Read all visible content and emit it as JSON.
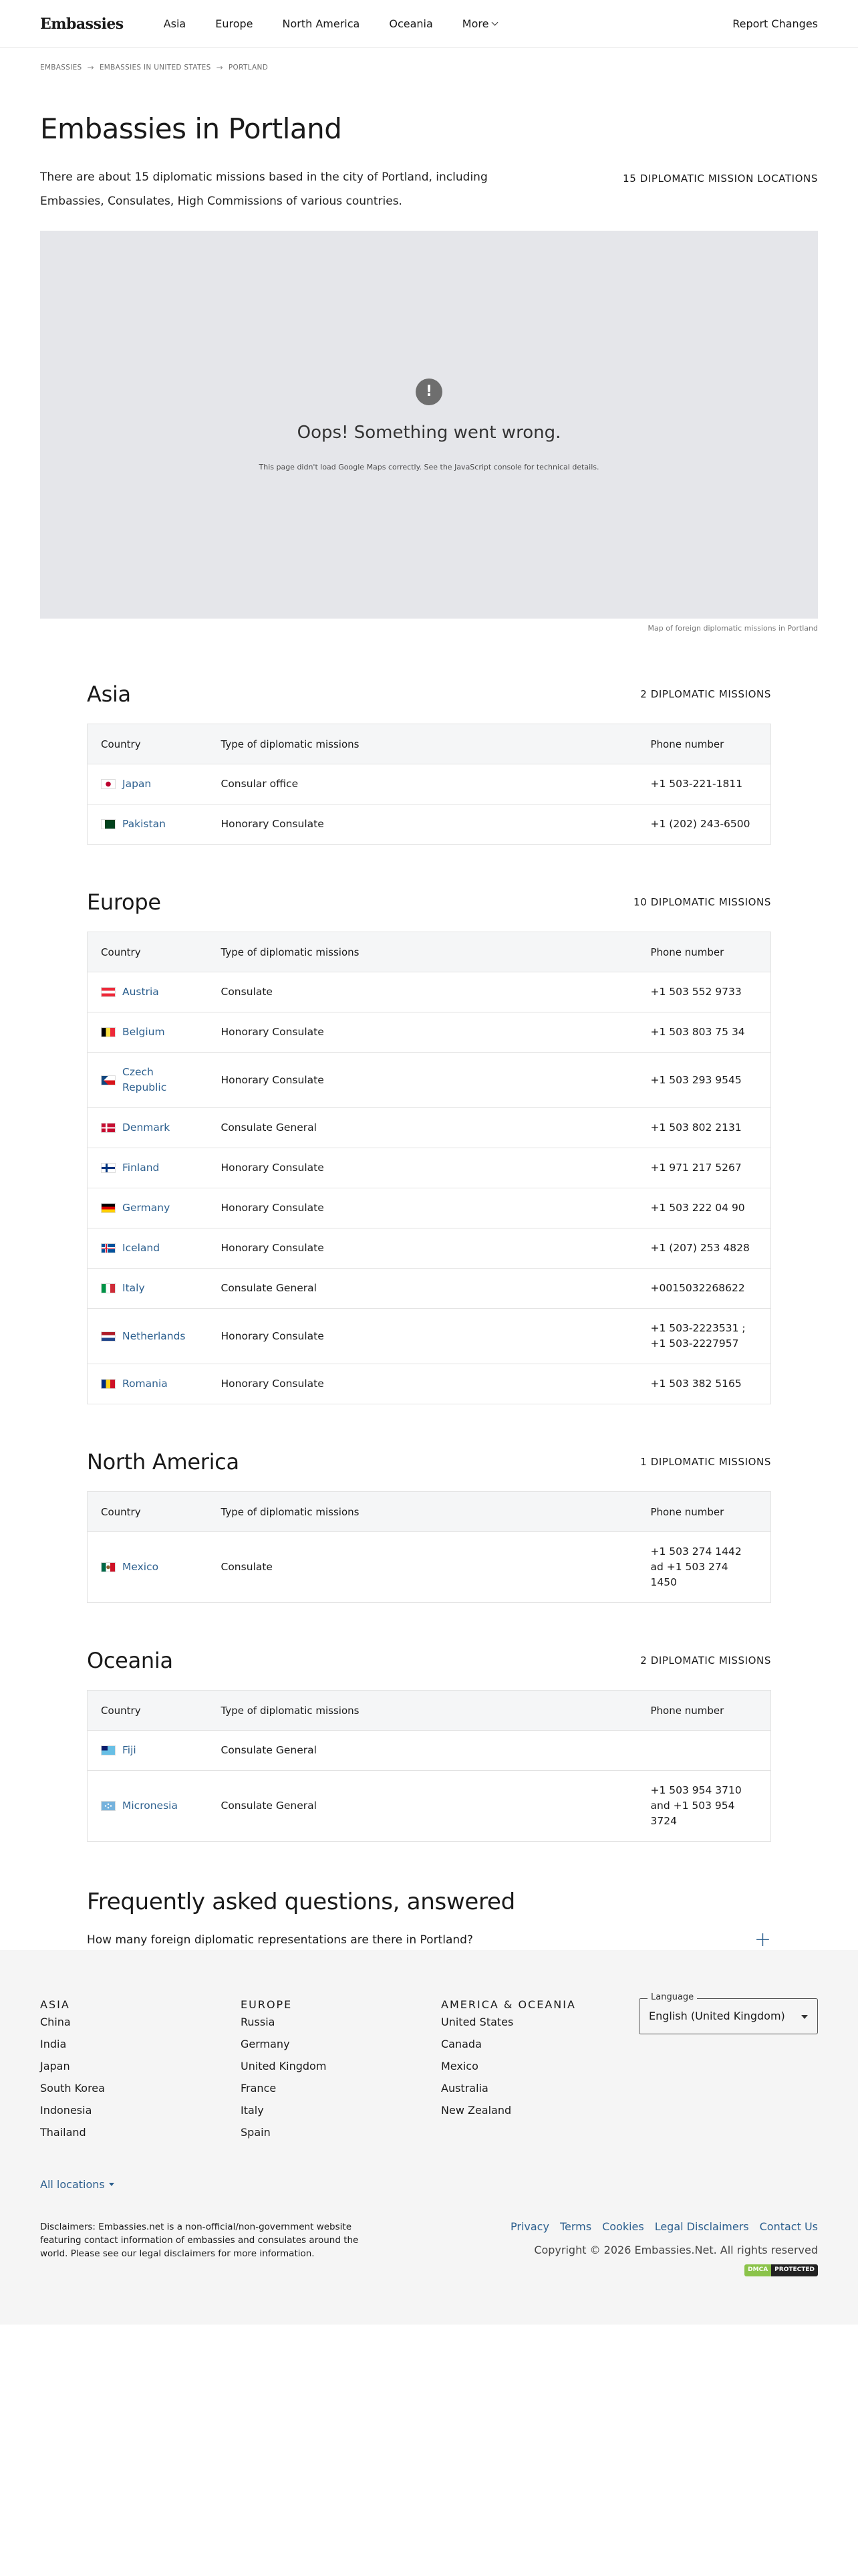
{
  "header": {
    "logo": "Embassies",
    "nav": [
      "Asia",
      "Europe",
      "North America",
      "Oceania",
      "More"
    ],
    "report": "Report Changes"
  },
  "breadcrumb": [
    "EMBASSIES",
    "EMBASSIES IN UNITED STATES",
    "PORTLAND"
  ],
  "hero": {
    "title": "Embassies in Portland",
    "locations": "15 DIPLOMATIC MISSION LOCATIONS",
    "intro": "There are about 15 diplomatic missions based in the city of Portland, including Embassies, Consulates, High Commissions of various countries."
  },
  "map": {
    "error_title": "Oops! Something went wrong.",
    "error_desc": "This page didn't load Google Maps correctly. See the JavaScript console for technical details.",
    "caption": "Map of foreign diplomatic missions in Portland"
  },
  "table_headers": [
    "Country",
    "Type of diplomatic missions",
    "Phone number"
  ],
  "regions": [
    {
      "name": "Asia",
      "count": "2 DIPLOMATIC MISSIONS",
      "rows": [
        {
          "country": "Japan",
          "type": "Consular office",
          "phone": "+1 503-221-1811",
          "flag": "japan"
        },
        {
          "country": "Pakistan",
          "type": "Honorary Consulate",
          "phone": "+1 (202) 243-6500",
          "flag": "pakistan"
        }
      ]
    },
    {
      "name": "Europe",
      "count": "10 DIPLOMATIC MISSIONS",
      "rows": [
        {
          "country": "Austria",
          "type": "Consulate",
          "phone": "+1 503 552 9733",
          "flag": "austria"
        },
        {
          "country": "Belgium",
          "type": "Honorary Consulate",
          "phone": "+1 503 803 75 34",
          "flag": "belgium"
        },
        {
          "country": "Czech Republic",
          "type": "Honorary Consulate",
          "phone": "+1 503 293 9545",
          "flag": "czech"
        },
        {
          "country": "Denmark",
          "type": "Consulate General",
          "phone": "+1 503 802 2131",
          "flag": "denmark"
        },
        {
          "country": "Finland",
          "type": "Honorary Consulate",
          "phone": "+1 971 217 5267",
          "flag": "finland"
        },
        {
          "country": "Germany",
          "type": "Honorary Consulate",
          "phone": "+1 503 222 04 90",
          "flag": "germany"
        },
        {
          "country": "Iceland",
          "type": "Honorary Consulate",
          "phone": "+1 (207) 253 4828",
          "flag": "iceland"
        },
        {
          "country": "Italy",
          "type": "Consulate General",
          "phone": "+0015032268622",
          "flag": "italy"
        },
        {
          "country": "Netherlands",
          "type": "Honorary Consulate",
          "phone": "+1 503-2223531 ; +1 503-2227957",
          "flag": "netherlands"
        },
        {
          "country": "Romania",
          "type": "Honorary Consulate",
          "phone": "+1 503 382 5165",
          "flag": "romania"
        }
      ]
    },
    {
      "name": "North America",
      "count": "1 DIPLOMATIC MISSIONS",
      "rows": [
        {
          "country": "Mexico",
          "type": "Consulate",
          "phone": "+1 503 274 1442 ad +1 503 274 1450",
          "flag": "mexico"
        }
      ]
    },
    {
      "name": "Oceania",
      "count": "2 DIPLOMATIC MISSIONS",
      "rows": [
        {
          "country": "Fiji",
          "type": "Consulate General",
          "phone": "",
          "flag": "fiji"
        },
        {
          "country": "Micronesia",
          "type": "Consulate General",
          "phone": "+1 503 954 3710 and +1 503 954 3724",
          "flag": "micronesia"
        }
      ]
    }
  ],
  "faq": {
    "title": "Frequently asked questions, answered",
    "question": "How many foreign diplomatic representations are there in Portland?"
  },
  "footer": {
    "columns": [
      {
        "title": "ASIA",
        "links": [
          "China",
          "India",
          "Japan",
          "South Korea",
          "Indonesia",
          "Thailand"
        ]
      },
      {
        "title": "EUROPE",
        "links": [
          "Russia",
          "Germany",
          "United Kingdom",
          "France",
          "Italy",
          "Spain"
        ]
      },
      {
        "title": "AMERICA & OCEANIA",
        "links": [
          "United States",
          "Canada",
          "Mexico",
          "Australia",
          "New Zealand"
        ]
      }
    ],
    "language_label": "Language",
    "language_value": "English (United Kingdom)",
    "all_locations": "All locations",
    "disclaimer": "Disclaimers: Embassies.net is a non-official/non-government website featuring contact information of embassies and consulates around the world. Please see our legal disclaimers for more information.",
    "legal_links": [
      "Privacy",
      "Terms",
      "Cookies",
      "Legal Disclaimers",
      "Contact Us"
    ],
    "copyright": "Copyright © 2026 Embassies.Net. All rights reserved",
    "dmca_left": "DMCA",
    "dmca_right": "PROTECTED"
  },
  "colors": {
    "link": "#2c5f8e",
    "map_bg": "#e5e6ea",
    "footer_bg": "#f5f5f5"
  }
}
